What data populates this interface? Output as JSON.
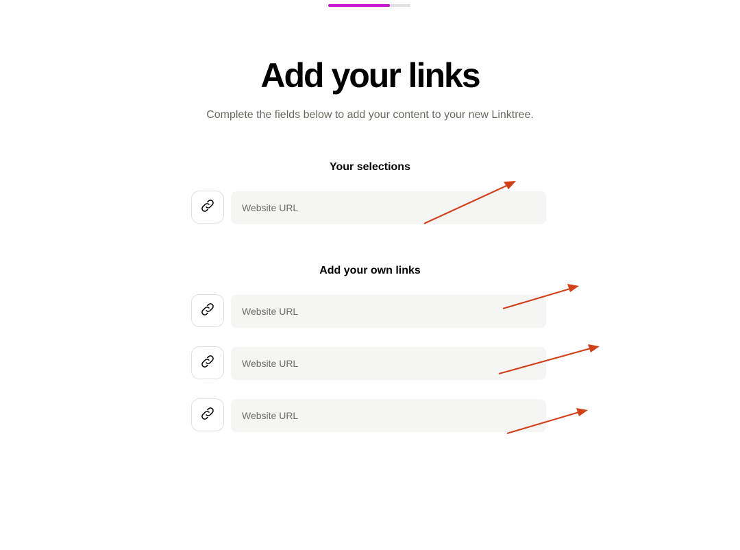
{
  "progress": {
    "fraction": 0.75,
    "fill_color": "#c51bd3",
    "track_color": "#e0e0dc"
  },
  "header": {
    "title": "Add your links",
    "subtitle": "Complete the fields below to add your content to your new Linktree."
  },
  "selections": {
    "heading": "Your selections",
    "links": [
      {
        "icon": "link-icon",
        "placeholder": "Website URL",
        "value": ""
      }
    ]
  },
  "own_links": {
    "heading": "Add your own links",
    "links": [
      {
        "icon": "link-icon",
        "placeholder": "Website URL",
        "value": ""
      },
      {
        "icon": "link-icon",
        "placeholder": "Website URL",
        "value": ""
      },
      {
        "icon": "link-icon",
        "placeholder": "Website URL",
        "value": ""
      }
    ]
  },
  "annotations": {
    "arrow_color": "#d2401a",
    "count": 4
  }
}
